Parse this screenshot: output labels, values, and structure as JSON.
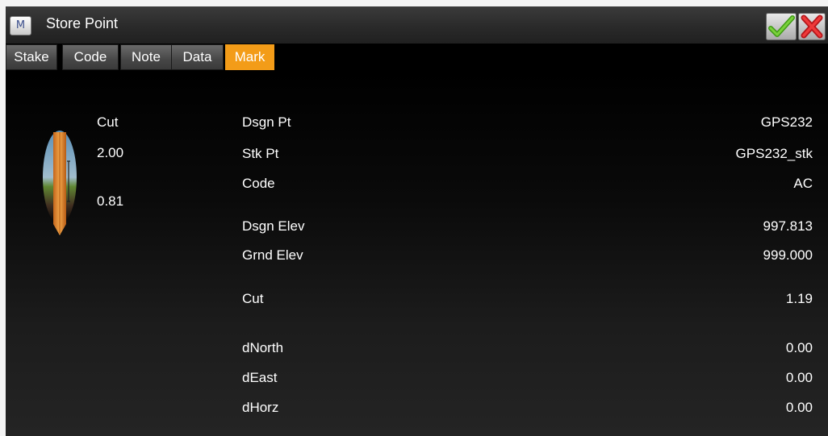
{
  "window": {
    "title": "Store Point",
    "app_icon_glyph": "M",
    "ok_icon": "green-checkmark-icon",
    "cancel_icon": "red-x-icon"
  },
  "tabs": [
    {
      "label": "Stake",
      "active": false
    },
    {
      "label": "Code",
      "active": false
    },
    {
      "label": "Note",
      "active": false
    },
    {
      "label": "Data",
      "active": false
    },
    {
      "label": "Mark",
      "active": true
    }
  ],
  "left_panel": {
    "cut_label": "Cut",
    "value_top": "2.00",
    "value_bottom": "0.81"
  },
  "fields": [
    {
      "label": "Dsgn Pt",
      "value": "GPS232"
    },
    {
      "label": "Stk Pt",
      "value": "GPS232_stk"
    },
    {
      "label": "Code",
      "value": "AC"
    },
    {
      "label": "Dsgn Elev",
      "value": "997.813"
    },
    {
      "label": "Grnd Elev",
      "value": "999.000"
    },
    {
      "label": "Cut",
      "value": "1.19"
    },
    {
      "label": "dNorth",
      "value": "0.00"
    },
    {
      "label": "dEast",
      "value": "0.00"
    },
    {
      "label": "dHorz",
      "value": "0.00"
    }
  ],
  "colors": {
    "active_tab": "#f39c18",
    "background": "#000000",
    "ok": "#4caf1e",
    "cancel": "#e0262a"
  }
}
